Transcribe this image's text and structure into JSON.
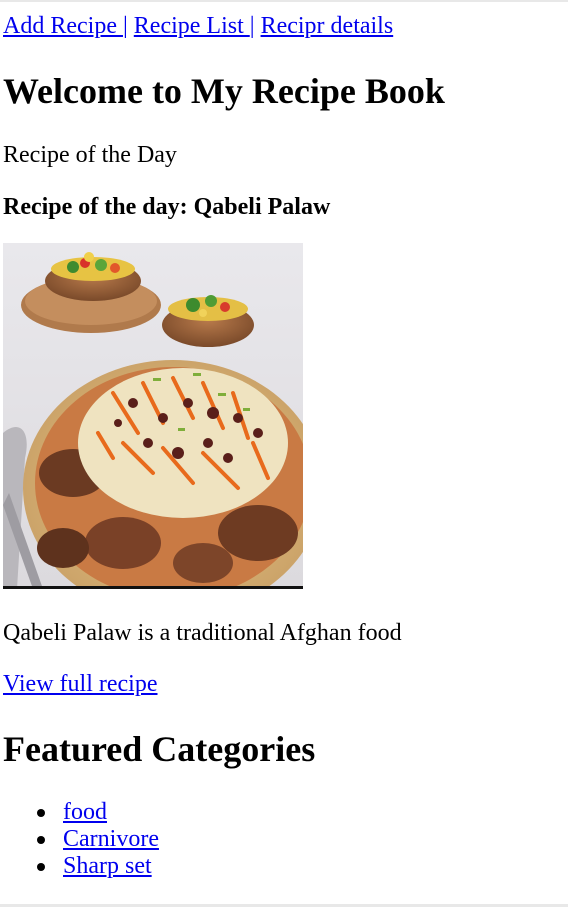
{
  "nav": {
    "links": [
      "Add Recipe ",
      "Recipe List ",
      "Recipr details"
    ],
    "separator": "|"
  },
  "main": {
    "title": "Welcome to My Recipe Book",
    "recipe_of_day_label": "Recipe of the Day",
    "recipe_of_day_heading": "Recipe of the day: Qabeli Palaw",
    "description": "Qabeli Palaw is a traditional Afghan food",
    "view_link": "View full recipe"
  },
  "featured": {
    "heading": "Featured Categories",
    "categories": [
      "food",
      "Carnivore",
      "Sharp set"
    ]
  },
  "colors": {
    "link": "#0000ee",
    "text": "#000000",
    "background": "#ffffff"
  }
}
